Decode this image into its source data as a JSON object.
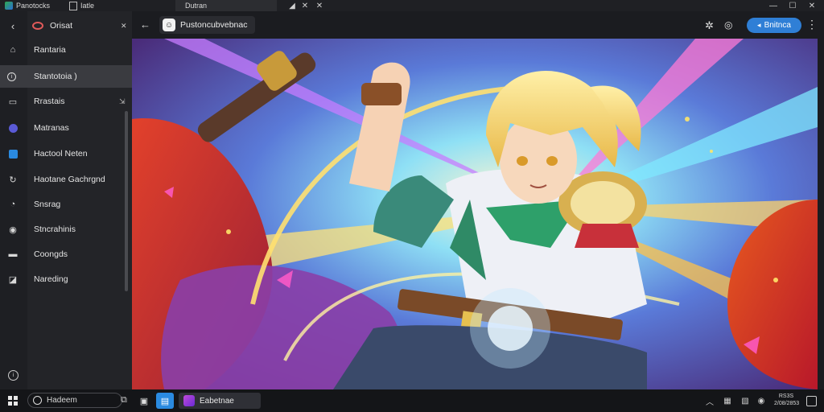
{
  "titlebar": {
    "tab1_label": "Panotocks",
    "tab2_label": "Iatle",
    "tab3_label": "Dutran",
    "icon_logo": "app-logo-icon",
    "controls": {
      "minimize": "—",
      "maximize": "☐",
      "close": "✕"
    }
  },
  "sidebar": {
    "header_label": "Orisat",
    "items": [
      {
        "label": "Rantaria",
        "icon": "home-icon"
      },
      {
        "label": "Stantotoia )",
        "icon": "info-icon"
      },
      {
        "label": "Rrastais",
        "icon": "folder-icon"
      },
      {
        "label": "Matranas",
        "icon": "circle-dot-icon"
      },
      {
        "label": "Hactool Neten",
        "icon": "window-icon"
      },
      {
        "label": "Haotane Gachrgnd",
        "icon": "refresh-icon"
      },
      {
        "label": "Snsrag",
        "icon": "tag-icon"
      },
      {
        "label": "Stncrahinis",
        "icon": "shield-icon"
      },
      {
        "label": "Coongds",
        "icon": "square-icon"
      },
      {
        "label": "Nareding",
        "icon": "bookmark-icon"
      }
    ]
  },
  "header": {
    "title": "Pustoncubvebnac",
    "button_label": "Bnitnca"
  },
  "taskbar": {
    "search_label": "Hadeem",
    "app_label": "Eabetnae",
    "clock_line1": "RS3S",
    "clock_line2": "2/08/2853"
  },
  "colors": {
    "accent": "#2f7fd6",
    "sidebar_bg": "#232428",
    "active_item": "#3a3b40"
  }
}
